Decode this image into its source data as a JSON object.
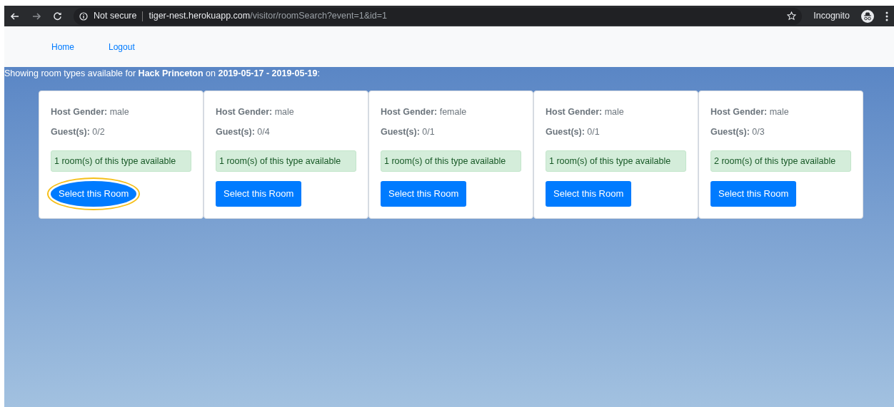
{
  "browser": {
    "security": "Not secure",
    "url_host": "tiger-nest.herokuapp.com",
    "url_path": "/visitor/roomSearch?event=1&id=1",
    "profile": "Incognito"
  },
  "nav": [
    {
      "label": "Home"
    },
    {
      "label": "Logout"
    }
  ],
  "heading": "Showing room types available for **Hack Princeton** on **2019-05-17 - 2019-05-19**:",
  "rooms": [
    {
      "host": "**Host Gender:** male",
      "guests": "**Guest(s):** 0/2",
      "availability": "1 room(s) of this type available",
      "button": "Select this Room",
      "highlighted": true
    },
    {
      "host": "**Host Gender:** male",
      "guests": "**Guest(s):** 0/4",
      "availability": "1 room(s) of this type available",
      "button": "Select this Room",
      "highlighted": false
    },
    {
      "host": "**Host Gender:** female",
      "guests": "**Guest(s):** 0/1",
      "availability": "1 room(s) of this type available",
      "button": "Select this Room",
      "highlighted": false
    },
    {
      "host": "**Host Gender:** male",
      "guests": "**Guest(s):** 0/1",
      "availability": "1 room(s) of this type available",
      "button": "Select this Room",
      "highlighted": false
    },
    {
      "host": "**Host Gender:** male",
      "guests": "**Guest(s):** 0/3",
      "availability": "2 room(s) of this type available",
      "button": "Select this Room",
      "highlighted": false
    }
  ]
}
